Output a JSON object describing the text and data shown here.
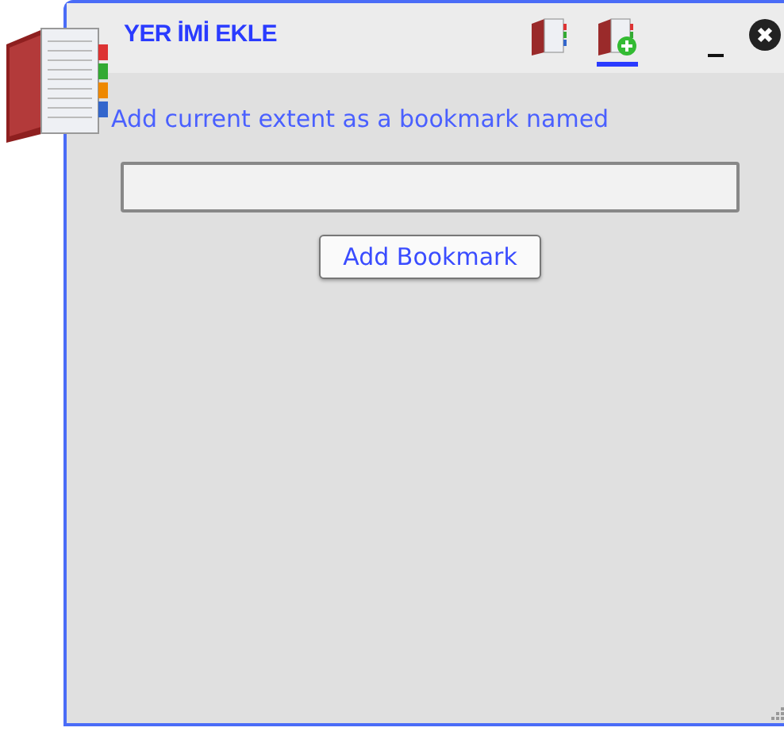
{
  "window": {
    "title": "YER İMİ EKLE"
  },
  "toolbar": [
    {
      "selected": false
    },
    {
      "selected": true
    }
  ],
  "prompt": "Add current extent as a bookmark named",
  "buttons": [
    "Add Bookmark"
  ]
}
